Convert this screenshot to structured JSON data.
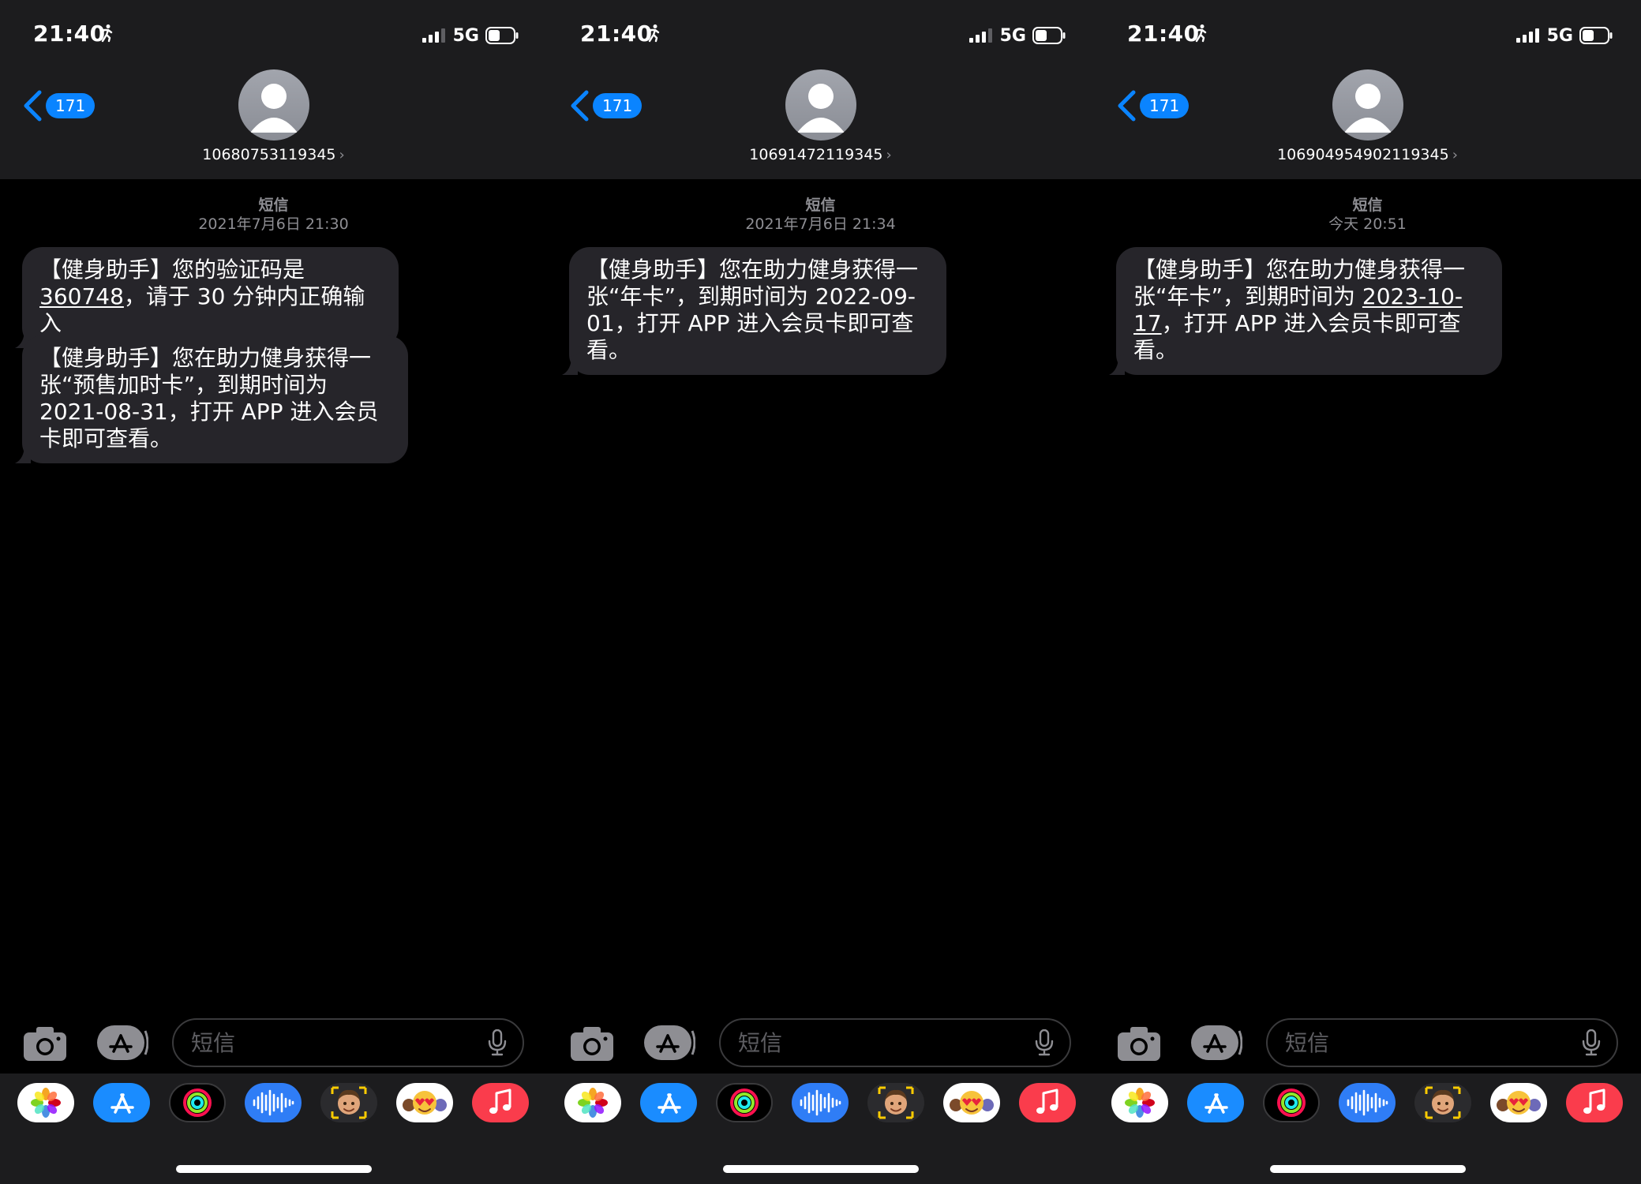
{
  "phones": [
    {
      "status": {
        "time": "21:40",
        "network": "5G"
      },
      "nav": {
        "back_badge": "171",
        "contact": "10680753119345"
      },
      "meta": {
        "service": "短信",
        "timestamp": "2021年7月6日 21:30"
      },
      "messages": [
        {
          "pre": "【健身助手】您的验证码是",
          "link": "360748",
          "post": "，请于 30 分钟内正确输入"
        },
        {
          "pre": "【健身助手】您在助力健身获得一张“预售加时卡”，到期时间为 2021-08-31，打开 APP 进入会员卡即可查看。",
          "link": "",
          "post": ""
        }
      ],
      "input": {
        "placeholder": "短信"
      }
    },
    {
      "status": {
        "time": "21:40",
        "network": "5G"
      },
      "nav": {
        "back_badge": "171",
        "contact": "10691472119345"
      },
      "meta": {
        "service": "短信",
        "timestamp": "2021年7月6日 21:34"
      },
      "messages": [
        {
          "pre": "【健身助手】您在助力健身获得一张“年卡”，到期时间为 2022-09-01，打开 APP 进入会员卡即可查看。",
          "link": "",
          "post": ""
        }
      ],
      "input": {
        "placeholder": "短信"
      }
    },
    {
      "status": {
        "time": "21:40",
        "network": "5G"
      },
      "nav": {
        "back_badge": "171",
        "contact": "106904954902119345"
      },
      "meta": {
        "service": "短信",
        "timestamp": "今天 20:51"
      },
      "messages": [
        {
          "pre": "【健身助手】您在助力健身获得一张“年卡”，到期时间为 ",
          "link": "2023-10-17",
          "post": "，打开 APP 进入会员卡即可查看。"
        }
      ],
      "input": {
        "placeholder": "短信"
      }
    }
  ],
  "icons": {
    "status": [
      "activity-icon",
      "signal-icon",
      "battery-icon"
    ],
    "nav": [
      "back-chevron-icon",
      "avatar-icon",
      "chevron-right-icon"
    ],
    "input": [
      "camera-icon",
      "app-store-icon",
      "microphone-icon"
    ],
    "drawer": [
      "photos-icon",
      "app-store-icon",
      "activity-rings-icon",
      "audio-message-icon",
      "memoji-icon",
      "animoji-icon",
      "music-icon"
    ]
  },
  "colors": {
    "accent": "#0a84ff",
    "bubble": "#26252a",
    "header": "#1c1c1e",
    "background": "#000000"
  }
}
